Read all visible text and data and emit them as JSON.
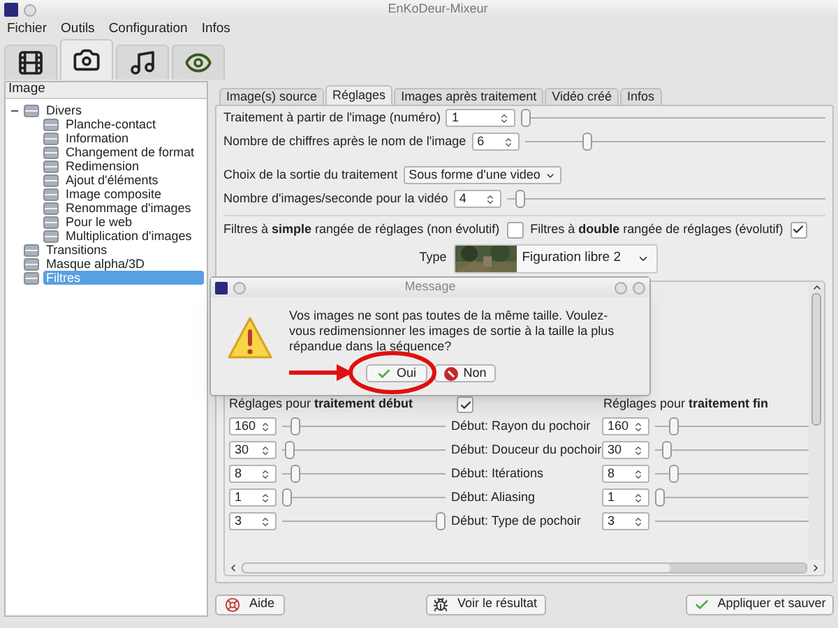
{
  "window": {
    "title": "EnKoDeur-Mixeur"
  },
  "menu": [
    "Fichier",
    "Outils",
    "Configuration",
    "Infos"
  ],
  "mode_tabs": [
    {
      "selected": false
    },
    {
      "selected": true
    },
    {
      "selected": false
    },
    {
      "selected": false
    }
  ],
  "tree": {
    "header": "Image",
    "items": [
      {
        "label": "Divers",
        "expanded": true,
        "selected": false,
        "children": [
          {
            "label": "Planche-contact",
            "selected": false
          },
          {
            "label": "Information",
            "selected": false
          },
          {
            "label": "Changement de format",
            "selected": false
          },
          {
            "label": "Redimension",
            "selected": false
          },
          {
            "label": "Ajout d'éléments",
            "selected": false
          },
          {
            "label": "Image composite",
            "selected": false
          },
          {
            "label": "Renommage d'images",
            "selected": false
          },
          {
            "label": "Pour le web",
            "selected": false
          },
          {
            "label": "Multiplication d'images",
            "selected": false
          }
        ]
      },
      {
        "label": "Transitions",
        "selected": false
      },
      {
        "label": "Masque alpha/3D",
        "selected": false
      },
      {
        "label": "Filtres",
        "selected": true
      }
    ]
  },
  "tabs": [
    {
      "label": "Image(s) source",
      "selected": false
    },
    {
      "label": "Réglages",
      "selected": true
    },
    {
      "label": "Images après traitement",
      "selected": false
    },
    {
      "label": "Vidéo créé",
      "selected": false
    },
    {
      "label": "Infos",
      "selected": false
    }
  ],
  "settings": [
    {
      "kind": "spin",
      "label": "Traitement à partir de l'image (numéro)",
      "value": "1",
      "level": 0
    },
    {
      "kind": "spin",
      "label": "Nombre de chiffres après le nom de l'image",
      "value": "6",
      "level": 0.2
    },
    {
      "kind": "combo",
      "label": "Choix de la sortie du traitement",
      "value": "Sous forme d'une video"
    },
    {
      "kind": "spin",
      "label": "Nombre d'images/seconde pour la vidéo",
      "value": "4",
      "level": 0.03
    }
  ],
  "filter_modes": [
    {
      "label": "Filtres à **simple** rangée de réglages (non évolutif)",
      "checked": false
    },
    {
      "label": "Filtres à **double** rangée de réglages (évolutif)",
      "checked": true
    }
  ],
  "type": {
    "label": "Type",
    "value": "Figuration libre 2"
  },
  "params": {
    "start_header": "Réglages pour **traitement début**",
    "linked": true,
    "end_header": "Réglages pour **traitement fin**",
    "rows": [
      {
        "label": "Début: Rayon du pochoir",
        "start": {
          "value": "160",
          "level": 0.05
        },
        "end": {
          "value": "160",
          "level": 0.1
        }
      },
      {
        "label": "Début: Douceur du pochoir",
        "start": {
          "value": "30",
          "level": 0.02
        },
        "end": {
          "value": "30",
          "level": 0.05
        }
      },
      {
        "label": "Début: Itérations",
        "start": {
          "value": "8",
          "level": 0.05
        },
        "end": {
          "value": "8",
          "level": 0.1
        }
      },
      {
        "label": "Début: Aliasing",
        "start": {
          "value": "1",
          "level": 0
        },
        "end": {
          "value": "1",
          "level": 0
        }
      },
      {
        "label": "Début: Type de pochoir",
        "start": {
          "value": "3",
          "level": 1
        },
        "end": {
          "value": "3"
        }
      }
    ]
  },
  "buttons": [
    {
      "kind": "help",
      "label": "Aide"
    },
    {
      "kind": "preview",
      "label": "Voir le résultat"
    },
    {
      "kind": "apply",
      "label": "Appliquer et sauver"
    }
  ],
  "dialog": {
    "title": "Message",
    "message": "Vos images ne sont pas toutes de la même taille. Voulez-vous redimensionner les images de sortie à la taille la plus répandue dans la séquence?",
    "buttons": [
      {
        "kind": "yes",
        "label": "Oui"
      },
      {
        "kind": "no",
        "label": "Non"
      }
    ]
  }
}
